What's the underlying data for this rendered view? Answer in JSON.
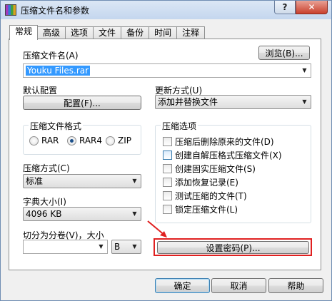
{
  "window": {
    "title": "压缩文件名和参数",
    "help_button": "?",
    "close_button": "✕"
  },
  "tabs": [
    "常规",
    "高级",
    "选项",
    "文件",
    "备份",
    "时间",
    "注释"
  ],
  "general": {
    "archive_name_label": "压缩文件名(A)",
    "archive_name_value": "Youku Files.rar",
    "browse_button": "浏览(B)...",
    "default_config_label": "默认配置",
    "config_button": "配置(F)...",
    "update_mode_label": "更新方式(U)",
    "update_mode_value": "添加并替换文件",
    "format_group_label": "压缩文件格式",
    "formats": [
      "RAR",
      "RAR4",
      "ZIP"
    ],
    "selected_format": "RAR4",
    "method_label": "压缩方式(C)",
    "method_value": "标准",
    "dict_label": "字典大小(I)",
    "dict_value": "4096 KB",
    "split_label": "切分为分卷(V)，大小",
    "split_value": "",
    "split_unit": "B",
    "options_group_label": "压缩选项",
    "options": [
      "压缩后删除原来的文件(D)",
      "创建自解压格式压缩文件(X)",
      "创建固实压缩文件(S)",
      "添加恢复记录(E)",
      "测试压缩的文件(T)",
      "锁定压缩文件(L)"
    ],
    "password_button": "设置密码(P)..."
  },
  "footer": {
    "ok": "确定",
    "cancel": "取消",
    "help": "帮助"
  },
  "colors": {
    "highlight": "#e02020",
    "selection": "#3399ff",
    "arrow": "#e02020"
  }
}
